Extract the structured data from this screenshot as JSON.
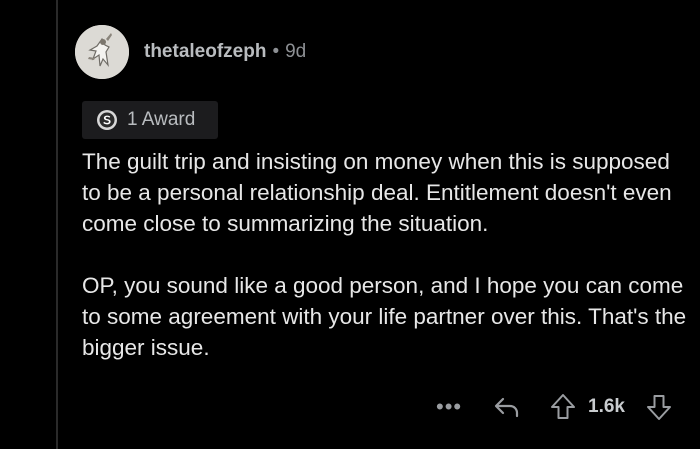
{
  "comment": {
    "username": "thetaleofzeph",
    "separator": "•",
    "age": "9d",
    "award": {
      "icon": "silver-award-icon",
      "label": "1 Award"
    },
    "paragraphs": [
      "The guilt trip and insisting on money when this is supposed to be a personal relationship deal. Entitlement doesn't even come close to summarizing the situation.",
      "OP, you sound like a good person, and I hope you can come to some agreement with your life partner over this. That's the bigger issue."
    ],
    "actions": {
      "more": "•••",
      "score": "1.6k"
    }
  },
  "colors": {
    "background": "#000000",
    "text": "#e7e7e7",
    "muted": "#8d9094",
    "award_bg": "#1c1c1e",
    "thread_line": "#2a2a2a"
  }
}
